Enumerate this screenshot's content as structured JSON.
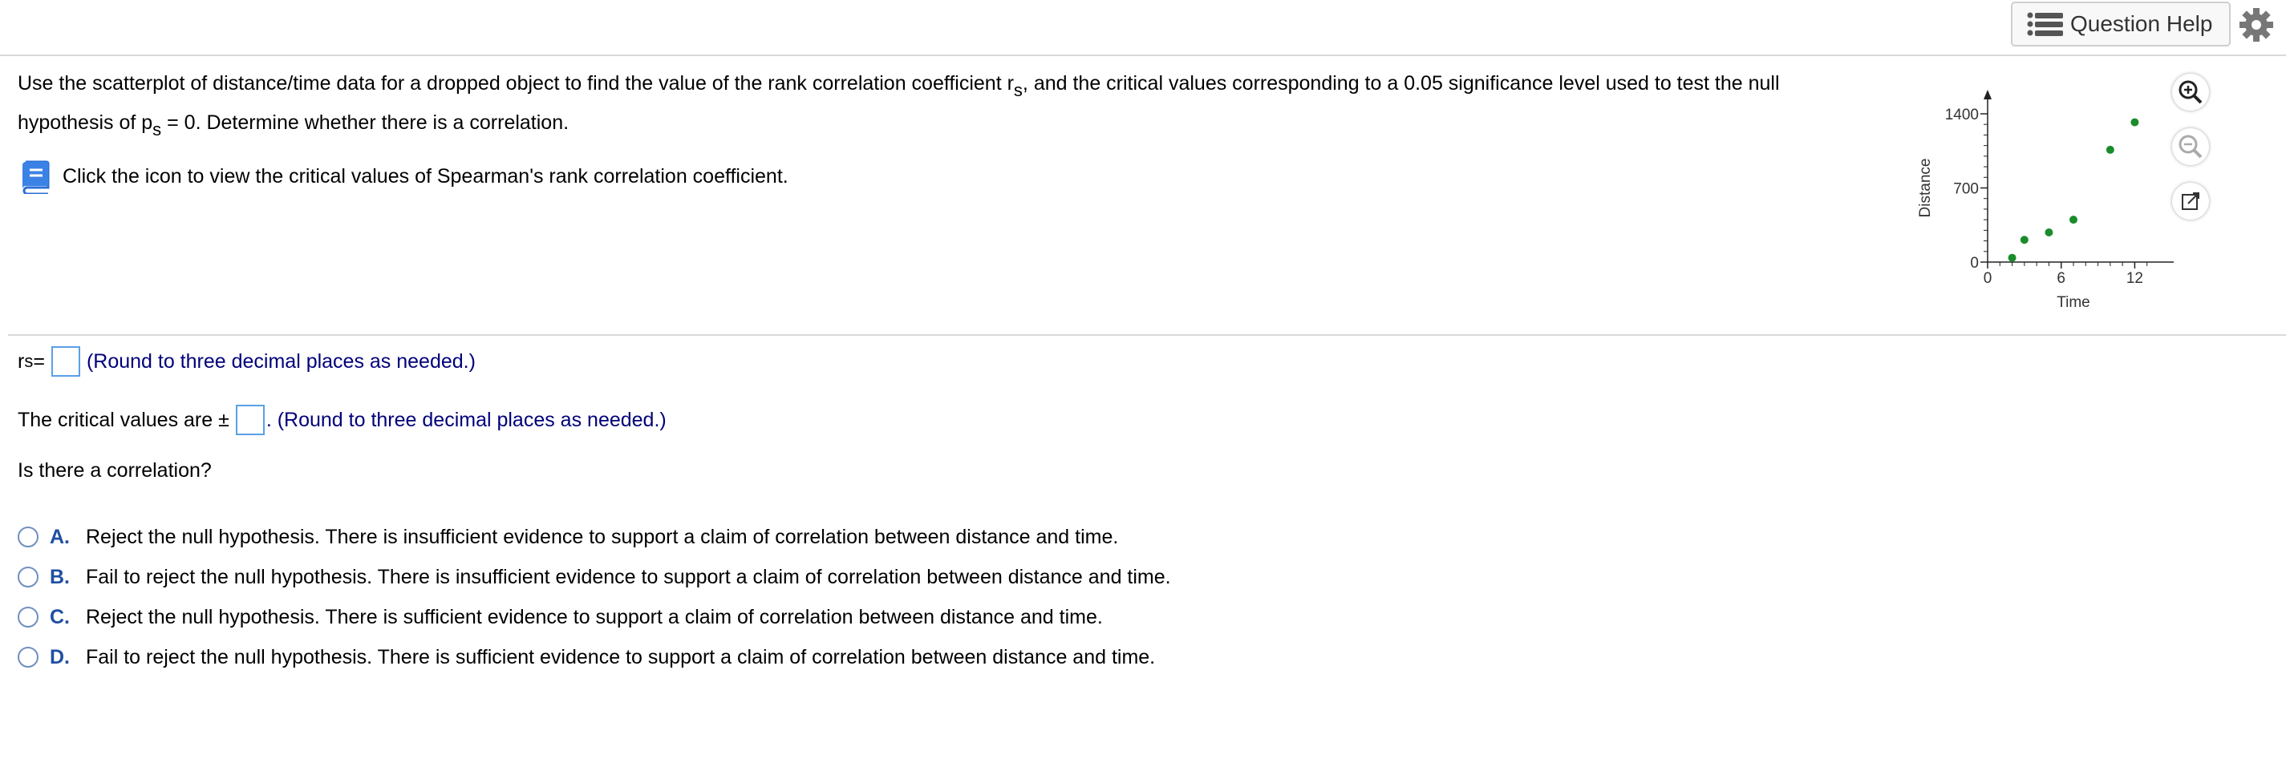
{
  "header": {
    "question_help_label": "Question Help",
    "question_help_icon": "list-icon",
    "settings_icon": "gear-icon"
  },
  "question": {
    "part1": "Use the scatterplot of distance/time data for a dropped object to find the value of the rank correlation coefficient r",
    "sub1": "s",
    "part2": ", and the critical values corresponding to a 0.05 significance level used to test the null",
    "part3": "hypothesis of p",
    "sub2": "s",
    "part4": " = 0. Determine whether there is a correlation.",
    "book_text": "Click the icon to view the critical values of Spearman's rank correlation coefficient.",
    "book_icon": "book-icon"
  },
  "chart_data": {
    "type": "scatter",
    "xlabel": "Time",
    "ylabel": "Distance",
    "xlim": [
      0,
      14
    ],
    "ylim": [
      0,
      1400
    ],
    "xticks": [
      "0",
      "6",
      "12"
    ],
    "yticks": [
      "0",
      "700",
      "1400"
    ],
    "points": [
      {
        "x": 2,
        "y": 40
      },
      {
        "x": 3,
        "y": 210
      },
      {
        "x": 5,
        "y": 280
      },
      {
        "x": 7,
        "y": 400
      },
      {
        "x": 10,
        "y": 1060
      },
      {
        "x": 12,
        "y": 1320
      }
    ],
    "point_color": "#1a8c2a"
  },
  "tools": [
    "zoom-in-icon",
    "zoom-out-icon",
    "popout-icon"
  ],
  "answers": {
    "rs_label": "r",
    "rs_sub": "s",
    "rs_eq": " =",
    "rs_hint": "(Round to three decimal places as needed.)",
    "crit_label": "The critical values are  ±",
    "crit_hint": ". (Round to three decimal places as needed.)",
    "corr_question": "Is there a correlation?"
  },
  "choices": [
    {
      "letter": "A.",
      "text": "Reject the null hypothesis. There is insufficient evidence to support a claim of correlation between distance and time."
    },
    {
      "letter": "B.",
      "text": "Fail to reject the null hypothesis. There is insufficient evidence to support a claim of correlation between distance and time."
    },
    {
      "letter": "C.",
      "text": "Reject the null hypothesis. There is sufficient evidence to support a claim of correlation between distance and time."
    },
    {
      "letter": "D.",
      "text": "Fail to reject the null hypothesis. There is sufficient evidence to support a claim of correlation between distance and time."
    }
  ]
}
